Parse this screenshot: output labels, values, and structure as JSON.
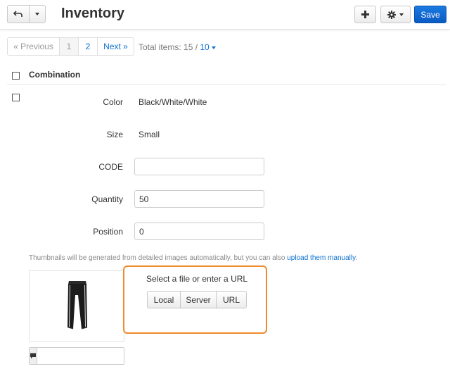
{
  "header": {
    "title": "Inventory",
    "save_label": "Save"
  },
  "pagination": {
    "prev_label": "« Previous",
    "pages": [
      "1",
      "2"
    ],
    "current_page": "1",
    "next_label": "Next »",
    "total_text": "Total items: 15 / ",
    "per_page": "10"
  },
  "table": {
    "column_header": "Combination"
  },
  "combination": {
    "color_label": "Color",
    "color_value": "Black/White/White",
    "size_label": "Size",
    "size_value": "Small",
    "code_label": "CODE",
    "code_value": "",
    "quantity_label": "Quantity",
    "quantity_value": "50",
    "position_label": "Position",
    "position_value": "0"
  },
  "images": {
    "hint_text": "Thumbnails will be generated from detailed images automatically, but you can also ",
    "hint_link": "upload them manually",
    "hint_end": ".",
    "uploader_caption": "Select a file or enter a URL",
    "buttons": [
      "Local",
      "Server",
      "URL"
    ],
    "alt_text_value": ""
  },
  "colors": {
    "accent": "#0b6fcf",
    "save_button": "#0b63cf",
    "highlight_border": "#ef8a2d"
  },
  "icons": {
    "back": "back-arrow-icon",
    "add": "plus-icon",
    "settings": "gear-icon",
    "comment": "speech-bubble-icon"
  }
}
